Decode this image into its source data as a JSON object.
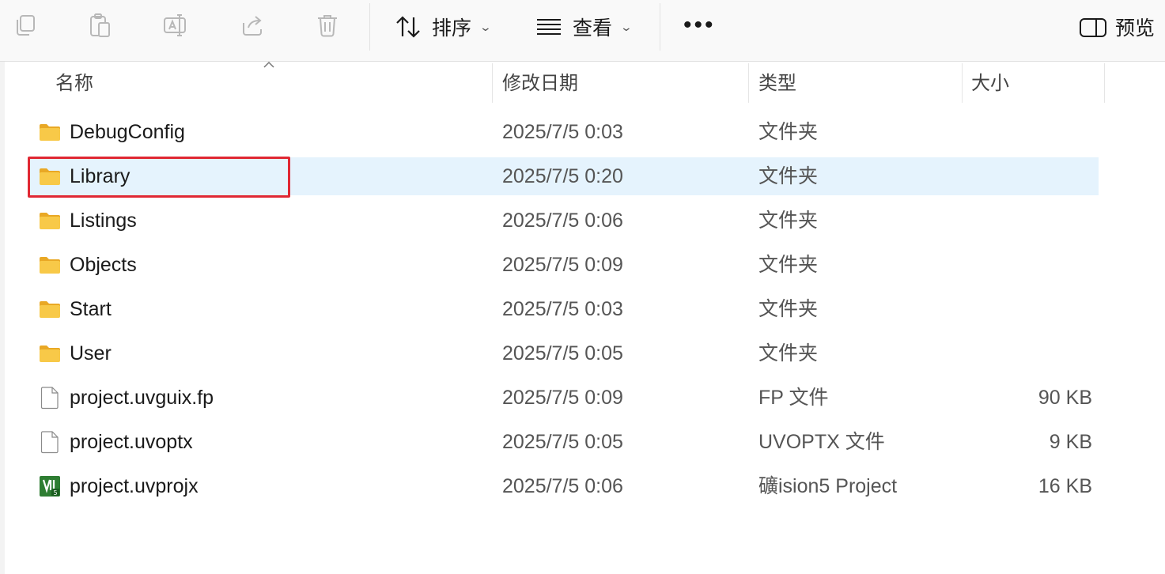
{
  "toolbar": {
    "copy_icon": "copy-icon",
    "paste_icon": "paste-icon",
    "rename_icon": "rename-icon",
    "share_icon": "share-icon",
    "delete_icon": "delete-icon",
    "sort_label": "排序",
    "view_label": "查看",
    "more_label": "•••",
    "preview_label": "预览"
  },
  "columns": {
    "name": "名称",
    "date": "修改日期",
    "type": "类型",
    "size": "大小"
  },
  "files": [
    {
      "name": "DebugConfig",
      "date": "2025/7/5 0:03",
      "type": "文件夹",
      "size": "",
      "icon": "folder-icon"
    },
    {
      "name": "Library",
      "date": "2025/7/5 0:20",
      "type": "文件夹",
      "size": "",
      "icon": "folder-icon",
      "selected": true
    },
    {
      "name": "Listings",
      "date": "2025/7/5 0:06",
      "type": "文件夹",
      "size": "",
      "icon": "folder-icon"
    },
    {
      "name": "Objects",
      "date": "2025/7/5 0:09",
      "type": "文件夹",
      "size": "",
      "icon": "folder-icon"
    },
    {
      "name": "Start",
      "date": "2025/7/5 0:03",
      "type": "文件夹",
      "size": "",
      "icon": "folder-icon"
    },
    {
      "name": "User",
      "date": "2025/7/5 0:05",
      "type": "文件夹",
      "size": "",
      "icon": "folder-icon"
    },
    {
      "name": "project.uvguix.fp",
      "date": "2025/7/5 0:09",
      "type": "FP 文件",
      "size": "90 KB",
      "icon": "file-icon"
    },
    {
      "name": "project.uvoptx",
      "date": "2025/7/5 0:05",
      "type": "UVOPTX 文件",
      "size": "9 KB",
      "icon": "file-icon"
    },
    {
      "name": "project.uvprojx",
      "date": "2025/7/5 0:06",
      "type": "礦ision5 Project",
      "size": "16 KB",
      "icon": "keil-project-icon"
    }
  ],
  "colors": {
    "selected_row": "#e5f3fd",
    "highlight_border": "#e02833",
    "folder": "#f8c948"
  }
}
